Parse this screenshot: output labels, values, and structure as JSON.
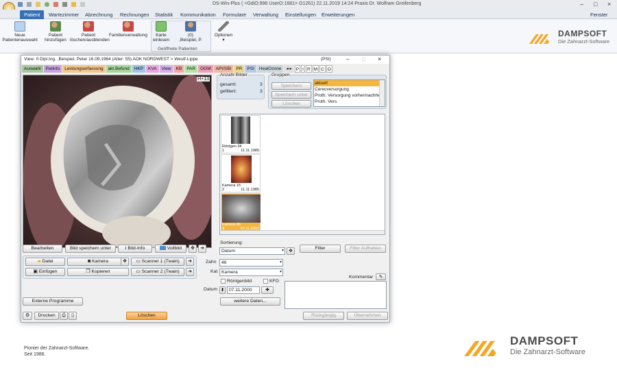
{
  "window": {
    "title": "DS-Win-Plus ( <GdiO:998 UserO:1681> G1261)   22.11.2019   14:24  Praxis Dr. Wolfram Greifenberg",
    "controls": [
      "–",
      "□",
      "×"
    ]
  },
  "menu": {
    "tabs": [
      "Patient",
      "Wartezimmer",
      "Abrechnung",
      "Rechnungen",
      "Statistik",
      "Kommunikation",
      "Formulare",
      "Verwaltung",
      "Einstellungen",
      "Erweiterungen"
    ],
    "right": "Fenster"
  },
  "ribbon": {
    "neue_label_1": "Neue",
    "neue_label_2": "Patientenauswahl",
    "hinzufuegen_1": "Patient",
    "hinzufuegen_2": "hinzufügen",
    "loeschen_1": "Patient",
    "loeschen_2": "löschen/ausblenden",
    "familie": "Familienverwaltung",
    "karte_1": "Karte",
    "karte_2": "einlesen",
    "offen_1": "(0)",
    "offen_2": ",Beispiel, P.",
    "offen_group": "Geöffnete Patienten",
    "optionen": "Optionen"
  },
  "logo": {
    "name": "DAMPSOFT",
    "tagline": "Die Zahnarzt-Software"
  },
  "dialog": {
    "title": "View: 0  Dipl.Ing. ,Beispiel, Peter  16.09.1964 (Alter: 55)  AOK NORDWEST > Westf-Lippe",
    "title_right": "(PSI)",
    "tabs": [
      {
        "label": "Auswahl",
        "color": "#a9c8a0"
      },
      {
        "label": "PatInfo",
        "color": "#c9a4e0"
      },
      {
        "label": "Leistungserfassung",
        "color": "#f3c68c"
      },
      {
        "label": "akt.Befund",
        "color": "#a6d89c"
      },
      {
        "label": "HKP",
        "color": "#a0c4e6"
      },
      {
        "label": "KVA",
        "color": "#e7a8df"
      },
      {
        "label": "View",
        "color": "#d2b0e8"
      },
      {
        "label": "KB",
        "color": "#f5a3a3"
      },
      {
        "label": "PAR",
        "color": "#b5e3a8"
      },
      {
        "label": "OGM",
        "color": "#ef9fb6"
      },
      {
        "label": "API/SBI",
        "color": "#f0b8a5"
      },
      {
        "label": "PR",
        "color": "#e9d98f"
      },
      {
        "label": "PSI",
        "color": "#b9c9e8"
      },
      {
        "label": "HealOzone",
        "color": "#cdd8dd"
      }
    ],
    "tab_icons": [
      "P",
      "I",
      "R",
      "M",
      "C",
      "O"
    ],
    "image_tag": "H+13",
    "anzahl": {
      "title": "Anzahl Bilder",
      "gesamt_label": "gesamt:",
      "gesamt": "3",
      "gefiltert_label": "gefiltert:",
      "gefiltert": "3"
    },
    "gruppen": {
      "title": "Gruppen",
      "buttons": [
        "Speichern",
        "Speichern unter",
        "Löschen"
      ],
      "items": [
        "aktuell",
        "Cerecversorgung",
        "Proth. Versorgung vorher/nachher",
        "Proth. Vers."
      ]
    },
    "thumbs": [
      {
        "caption": "Röntgen 34",
        "num": "1",
        "date": "11.11.1985"
      },
      {
        "caption": "Kamera 15",
        "num": "2",
        "date": "11.11.1985"
      },
      {
        "caption": "Kamera 46",
        "num": "3",
        "date": "07.11.2000"
      }
    ],
    "buttons": {
      "bearbeiten": "Bearbeiten",
      "speichern": "Bild speichern unter",
      "info": "Bild-Info",
      "vollbild": "Vollbild",
      "datei": "Datei",
      "kamera": "Kamera",
      "scanner1": "Scanner 1 (Twain)",
      "einfuegen": "Einfügen",
      "kopieren": "Kopieren",
      "scanner2": "Scanner 2 (Twain)",
      "externe": "Externe Programme",
      "drucken": "Drucken",
      "loeschen": "Löschen",
      "filter": "Filter",
      "filter_auf": "Filter Aufheben",
      "weitere": "weitere Daten...",
      "rueck": "Rückgängig",
      "ueber": "Übernehmen"
    },
    "form": {
      "sortierung_label": "Sortierung:",
      "sortierung": "Datum",
      "zahn_label": "Zahn",
      "zahn": "46",
      "kat_label": "Kat",
      "kat": "Kamera",
      "roentgen": "Röntgenbild",
      "kfo": "KFO",
      "datum_label": "Datum",
      "datum": "07.11.2000",
      "kommentar": "Kommentar"
    }
  },
  "footer": {
    "line1": "Pionier der Zahnarzt-Software.",
    "line2": "Seit 1986."
  },
  "colors": {
    "accent": "#3570b7",
    "logo_orange": "#f5a623",
    "selection": "#f5b640"
  }
}
